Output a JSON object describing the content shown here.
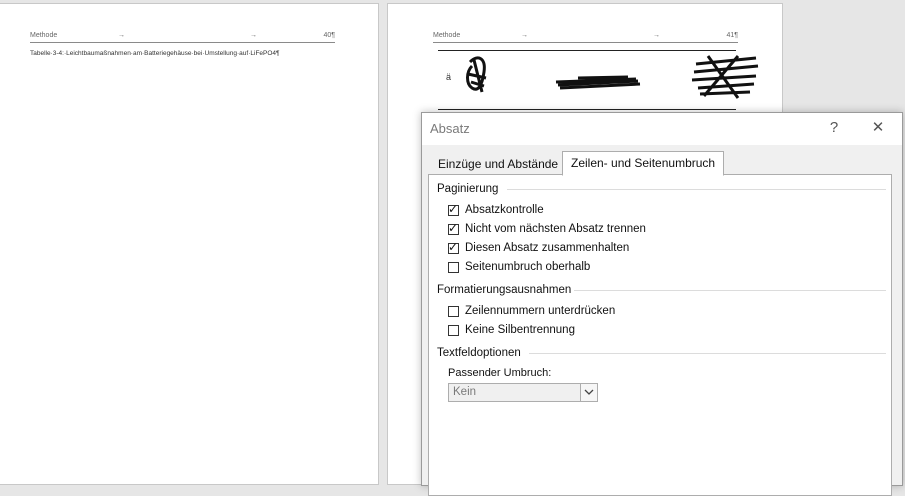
{
  "document": {
    "page1": {
      "header": {
        "left": "Methode",
        "arrow1": "→",
        "arrow2": "→",
        "right": "40¶"
      },
      "caption": "Tabelle·3-4:·Leichtbaumaßnahmen·am·Batteriegehäuse·bei·Umstellung·auf·LiFePO4¶"
    },
    "page2": {
      "header": {
        "left": "Methode",
        "arrow1": "→",
        "arrow2": "→",
        "right": "41¶"
      }
    }
  },
  "dialog": {
    "title": "Absatz",
    "help": "?",
    "close": "✕",
    "tabs": [
      {
        "label": "Einzüge und Abstände",
        "active": false
      },
      {
        "label": "Zeilen- und Seitenumbruch",
        "active": true
      }
    ],
    "sections": {
      "pagination": {
        "title": "Paginierung",
        "items": [
          {
            "label": "Absatzkontrolle",
            "checked": true
          },
          {
            "label": "Nicht vom nächsten Absatz trennen",
            "checked": true
          },
          {
            "label": "Diesen Absatz zusammenhalten",
            "checked": true
          },
          {
            "label": "Seitenumbruch oberhalb",
            "checked": false
          }
        ]
      },
      "formatting": {
        "title": "Formatierungsausnahmen",
        "items": [
          {
            "label": "Zeilennummern unterdrücken",
            "checked": false
          },
          {
            "label": "Keine Silbentrennung",
            "checked": false
          }
        ]
      },
      "textbox": {
        "title": "Textfeldoptionen",
        "wrap_label": "Passender Umbruch:",
        "wrap_value": "Kein"
      }
    }
  },
  "check_glyph": "✓"
}
